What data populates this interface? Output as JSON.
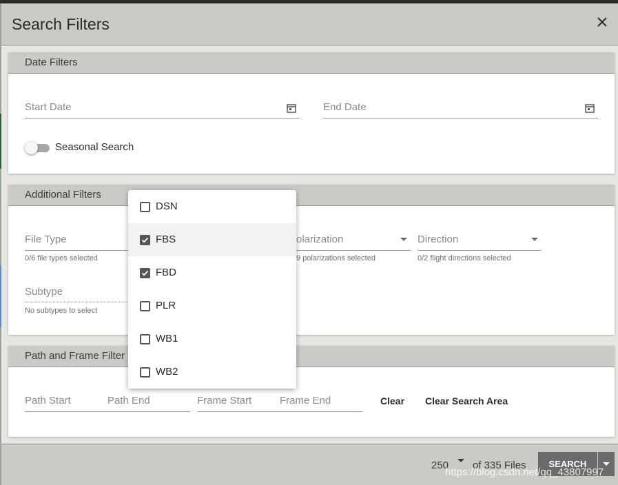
{
  "dialog": {
    "title": "Search Filters"
  },
  "date_filters": {
    "header": "Date Filters",
    "start_date_placeholder": "Start Date",
    "end_date_placeholder": "End Date",
    "seasonal_label": "Seasonal Search",
    "seasonal_enabled": false
  },
  "additional_filters": {
    "header": "Additional Filters",
    "file_type_label": "File Type",
    "file_type_hint": "0/6 file types selected",
    "polarization_label": "olarization",
    "polarization_hint": "9 polarizations selected",
    "direction_label": "Direction",
    "direction_hint": "0/2 flight directions selected",
    "subtype_label": "Subtype",
    "subtype_hint": "No subtypes to select"
  },
  "file_type_options": [
    {
      "label": "DSN",
      "checked": false
    },
    {
      "label": "FBS",
      "checked": true
    },
    {
      "label": "FBD",
      "checked": true
    },
    {
      "label": "PLR",
      "checked": false
    },
    {
      "label": "WB1",
      "checked": false
    },
    {
      "label": "WB2",
      "checked": false
    }
  ],
  "path_frame": {
    "header": "Path and Frame Filter",
    "path_start": "Path Start",
    "path_end": "Path End",
    "frame_start": "Frame Start",
    "frame_end": "Frame End",
    "clear_label": "Clear",
    "clear_area_label": "Clear Search Area"
  },
  "footer": {
    "page_size": "250",
    "files_text": "of 335 Files",
    "search_label": "SEARCH",
    "watermark": "https://blog.csdn.net/qq_43807997"
  },
  "colors": {
    "header_bg": "#cbcbc6",
    "body_bg": "#e6e6e2",
    "button_bg": "#6b6b6b",
    "checkbox": "#555555"
  }
}
